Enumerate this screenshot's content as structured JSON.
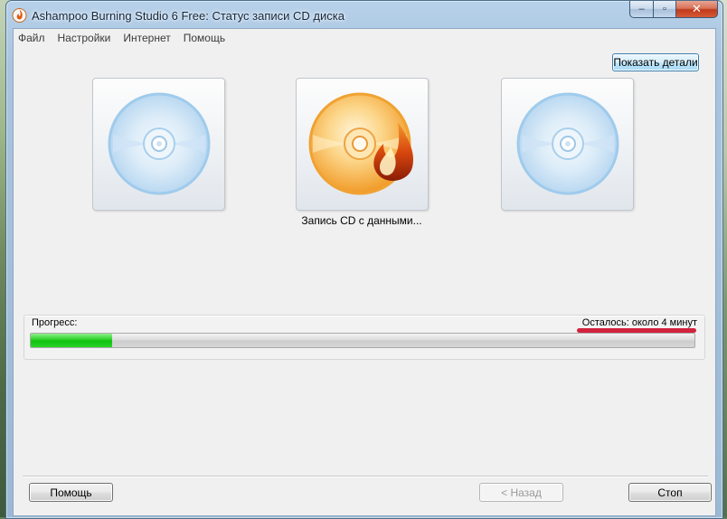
{
  "window": {
    "title": "Ashampoo Burning Studio 6 Free: Статус записи CD диска",
    "controls": {
      "minimize": "–",
      "maximize": "▫",
      "close": "✕"
    }
  },
  "menu": {
    "items": [
      {
        "label": "Файл"
      },
      {
        "label": "Настройки"
      },
      {
        "label": "Интернет"
      },
      {
        "label": "Помощь"
      }
    ]
  },
  "toolbar": {
    "show_details_label": "Показать детали"
  },
  "steps": {
    "items": [
      {
        "icon": "cd-disc-icon",
        "state": "inactive"
      },
      {
        "icon": "cd-burning-icon",
        "state": "active"
      },
      {
        "icon": "cd-disc-icon",
        "state": "inactive"
      }
    ],
    "active_caption": "Запись CD с данными..."
  },
  "progress": {
    "label": "Прогресс:",
    "remaining": "Осталось: около 4 минут",
    "percent": 12.3,
    "highlight_color": "#d2223d",
    "fill_color": "#10c20e"
  },
  "footer": {
    "help_label": "Помощь",
    "back_label": "< Назад",
    "stop_label": "Стоп"
  }
}
